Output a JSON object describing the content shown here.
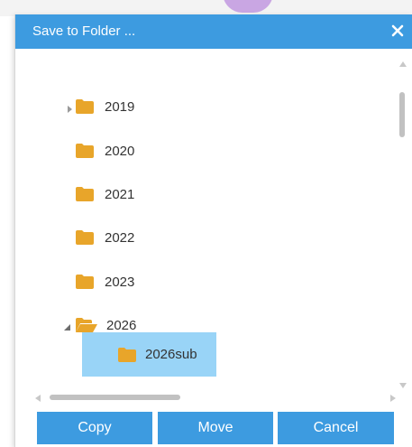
{
  "dialog": {
    "title": "Save to Folder ...",
    "close_icon": "close-icon"
  },
  "tree": {
    "nodes": [
      {
        "label": "2019",
        "state": "collapsed",
        "has_children": true,
        "icon": "folder-icon"
      },
      {
        "label": "2020",
        "has_children": false,
        "icon": "folder-icon"
      },
      {
        "label": "2021",
        "has_children": false,
        "icon": "folder-icon"
      },
      {
        "label": "2022",
        "has_children": false,
        "icon": "folder-icon"
      },
      {
        "label": "2023",
        "has_children": false,
        "icon": "folder-icon"
      },
      {
        "label": "2026",
        "state": "expanded",
        "has_children": true,
        "icon": "folder-open-icon"
      },
      {
        "label": "2026sub",
        "selected": true,
        "has_children": false,
        "icon": "folder-icon",
        "parent": "2026"
      }
    ]
  },
  "buttons": {
    "copy": "Copy",
    "move": "Move",
    "cancel": "Cancel"
  },
  "colors": {
    "accent": "#3d9be0",
    "selection": "#99d4f7",
    "folder": "#e8a52a"
  }
}
